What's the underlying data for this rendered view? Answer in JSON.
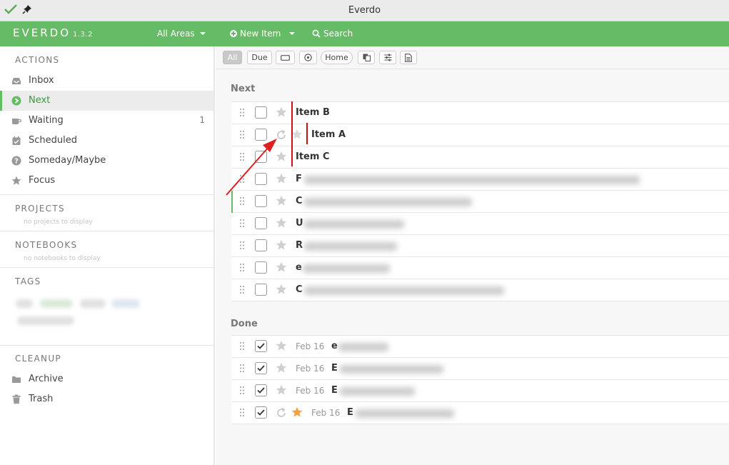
{
  "window": {
    "title": "Everdo"
  },
  "header": {
    "logo": "EVERDO",
    "version": "1.3.2",
    "areas_label": "All Areas",
    "new_item_label": "New Item",
    "search_label": "Search"
  },
  "sidebar": {
    "actions_title": "ACTIONS",
    "actions": [
      {
        "label": "Inbox",
        "icon": "inbox-icon",
        "count": ""
      },
      {
        "label": "Next",
        "icon": "next-arrow-icon",
        "count": ""
      },
      {
        "label": "Waiting",
        "icon": "coffee-cup-icon",
        "count": "1"
      },
      {
        "label": "Scheduled",
        "icon": "calendar-icon",
        "count": ""
      },
      {
        "label": "Someday/Maybe",
        "icon": "question-icon",
        "count": ""
      },
      {
        "label": "Focus",
        "icon": "star-icon",
        "count": ""
      }
    ],
    "projects_title": "PROJECTS",
    "projects_hint": "no projects to display",
    "notebooks_title": "NOTEBOOKS",
    "notebooks_hint": "no notebooks to display",
    "tags_title": "TAGS",
    "cleanup_title": "CLEANUP",
    "cleanup": [
      {
        "label": "Archive",
        "icon": "folder-icon"
      },
      {
        "label": "Trash",
        "icon": "trash-icon"
      }
    ]
  },
  "filters": {
    "all_label": "All",
    "due_label": "Due",
    "home_label": "Home"
  },
  "next_group": {
    "title": "Next",
    "items": [
      {
        "text": "Item B"
      },
      {
        "text": "Item A"
      },
      {
        "text": "Item C"
      },
      {
        "text": "F"
      },
      {
        "text": "C"
      },
      {
        "text": "U"
      },
      {
        "text": "R"
      },
      {
        "text": "e"
      },
      {
        "text": "C"
      }
    ]
  },
  "done_group": {
    "title": "Done",
    "items": [
      {
        "date": "Feb 16",
        "text": "e"
      },
      {
        "date": "Feb 16",
        "text": "E"
      },
      {
        "date": "Feb 16",
        "text": "E"
      },
      {
        "date": "Feb 16",
        "text": "E"
      }
    ]
  },
  "colors": {
    "brand_green": "#66bb66",
    "dependency_red": "#cc1111",
    "focus_star": "#f5a03a",
    "annotation_arrow": "#e02020"
  }
}
